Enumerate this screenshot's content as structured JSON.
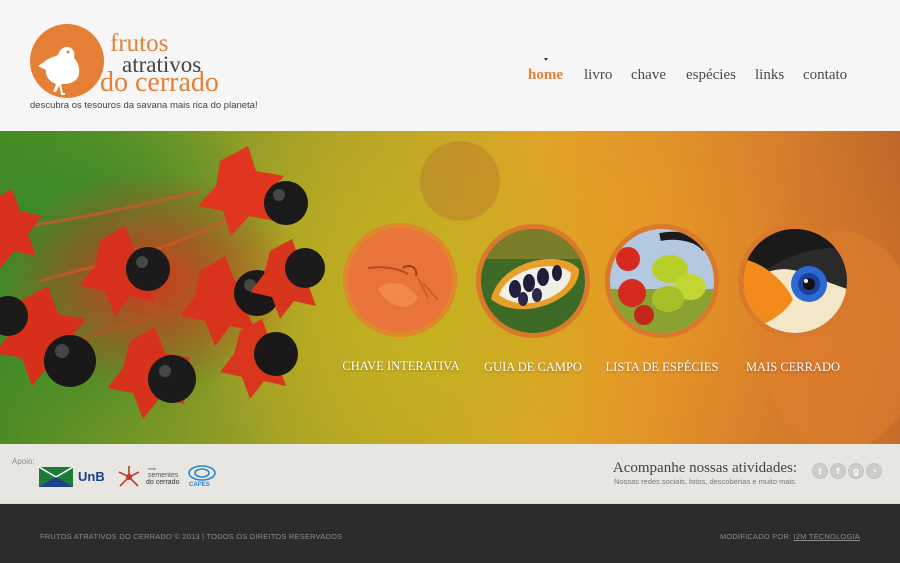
{
  "logo": {
    "line1": "frutos",
    "line2": "atrativos",
    "line3": "do cerrado",
    "tagline": "descubra os tesouros da savana mais rica do planeta!"
  },
  "nav": {
    "items": [
      {
        "label": "home",
        "active": true
      },
      {
        "label": "livro",
        "active": false
      },
      {
        "label": "chave",
        "active": false
      },
      {
        "label": "espécies",
        "active": false
      },
      {
        "label": "links",
        "active": false
      },
      {
        "label": "contato",
        "active": false
      }
    ]
  },
  "hero": {
    "features": [
      {
        "label": "CHAVE INTERATIVA",
        "icon": "bird-on-branch"
      },
      {
        "label": "GUIA DE CAMPO",
        "icon": "seed-pod"
      },
      {
        "label": "LISTA DE ESPÉCIES",
        "icon": "fruits"
      },
      {
        "label": "MAIS CERRADO",
        "icon": "toucan"
      }
    ]
  },
  "support": {
    "apoio_label": "Apoio:",
    "sponsors": {
      "unb": "UnB",
      "sementes_small": "rede",
      "sementes_line1": "sementes",
      "sementes_line2": "do cerrado",
      "capes": "CAPES"
    },
    "follow_title": "Acompanhe nossas atividades:",
    "follow_subtitle": "Nossas redes sociais, fotos, descobertas e muito mais.",
    "social_icons": [
      "twitter-icon",
      "facebook-icon",
      "google-plus-icon",
      "rss-icon"
    ]
  },
  "footer": {
    "copyright": "FRUTOS ATRATIVOS DO CERRADO © 2013  |  TODOS OS DIREITOS RESERVADOS",
    "modified_prefix": "MODIFICADO POR: ",
    "modified_link": "I2M TECNOLOGIA"
  },
  "colors": {
    "accent": "#e57f35",
    "footer_bg": "#2c2c2c",
    "support_bg": "#e8e6e1",
    "header_bg": "#f6f6f6"
  }
}
